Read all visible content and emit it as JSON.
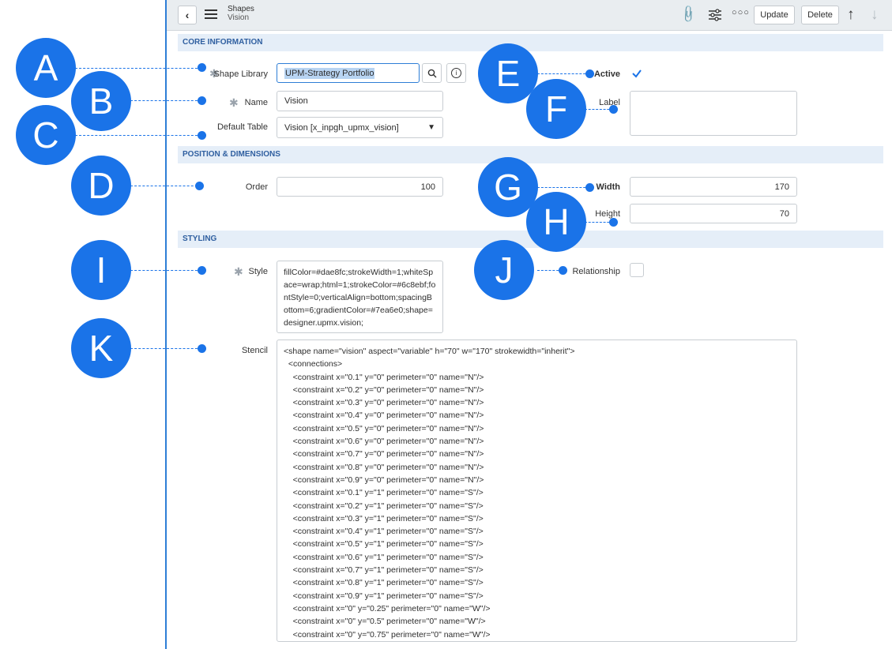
{
  "header": {
    "title": "Shapes",
    "subtitle": "Vision",
    "update_label": "Update",
    "delete_label": "Delete"
  },
  "sections": {
    "core": "CORE INFORMATION",
    "position": "POSITION & DIMENSIONS",
    "styling": "STYLING"
  },
  "fields": {
    "shape_library": {
      "label": "Shape Library",
      "value": "UPM-Strategy Portfolio"
    },
    "name": {
      "label": "Name",
      "value": "Vision"
    },
    "default_table": {
      "label": "Default Table",
      "value": "Vision [x_inpgh_upmx_vision]"
    },
    "active": {
      "label": "Active",
      "checked": true
    },
    "label": {
      "label": "Label",
      "value": ""
    },
    "order": {
      "label": "Order",
      "value": "100"
    },
    "width": {
      "label": "Width",
      "value": "170"
    },
    "height": {
      "label": "Height",
      "value": "70"
    },
    "style": {
      "label": "Style",
      "value": "fillColor=#dae8fc;strokeWidth=1;whiteSpace=wrap;html=1;strokeColor=#6c8ebf;fontStyle=0;verticalAlign=bottom;spacingBottom=6;gradientColor=#7ea6e0;shape=designer.upmx.vision;"
    },
    "relationship": {
      "label": "Relationship",
      "checked": false
    },
    "stencil": {
      "label": "Stencil",
      "value": "<shape name=\"vision\" aspect=\"variable\" h=\"70\" w=\"170\" strokewidth=\"inherit\">\n  <connections>\n    <constraint x=\"0.1\" y=\"0\" perimeter=\"0\" name=\"N\"/>\n    <constraint x=\"0.2\" y=\"0\" perimeter=\"0\" name=\"N\"/>\n    <constraint x=\"0.3\" y=\"0\" perimeter=\"0\" name=\"N\"/>\n    <constraint x=\"0.4\" y=\"0\" perimeter=\"0\" name=\"N\"/>\n    <constraint x=\"0.5\" y=\"0\" perimeter=\"0\" name=\"N\"/>\n    <constraint x=\"0.6\" y=\"0\" perimeter=\"0\" name=\"N\"/>\n    <constraint x=\"0.7\" y=\"0\" perimeter=\"0\" name=\"N\"/>\n    <constraint x=\"0.8\" y=\"0\" perimeter=\"0\" name=\"N\"/>\n    <constraint x=\"0.9\" y=\"0\" perimeter=\"0\" name=\"N\"/>\n    <constraint x=\"0.1\" y=\"1\" perimeter=\"0\" name=\"S\"/>\n    <constraint x=\"0.2\" y=\"1\" perimeter=\"0\" name=\"S\"/>\n    <constraint x=\"0.3\" y=\"1\" perimeter=\"0\" name=\"S\"/>\n    <constraint x=\"0.4\" y=\"1\" perimeter=\"0\" name=\"S\"/>\n    <constraint x=\"0.5\" y=\"1\" perimeter=\"0\" name=\"S\"/>\n    <constraint x=\"0.6\" y=\"1\" perimeter=\"0\" name=\"S\"/>\n    <constraint x=\"0.7\" y=\"1\" perimeter=\"0\" name=\"S\"/>\n    <constraint x=\"0.8\" y=\"1\" perimeter=\"0\" name=\"S\"/>\n    <constraint x=\"0.9\" y=\"1\" perimeter=\"0\" name=\"S\"/>\n    <constraint x=\"0\" y=\"0.25\" perimeter=\"0\" name=\"W\"/>\n    <constraint x=\"0\" y=\"0.5\" perimeter=\"0\" name=\"W\"/>\n    <constraint x=\"0\" y=\"0.75\" perimeter=\"0\" name=\"W\"/>"
    }
  },
  "callouts": {
    "a": "A",
    "b": "B",
    "c": "C",
    "d": "D",
    "e": "E",
    "f": "F",
    "g": "G",
    "h": "H",
    "i": "I",
    "j": "J",
    "k": "K"
  },
  "colors": {
    "accent": "#1a73e8",
    "section_bg": "#e5eef8",
    "header_bg": "#e9edf0"
  }
}
